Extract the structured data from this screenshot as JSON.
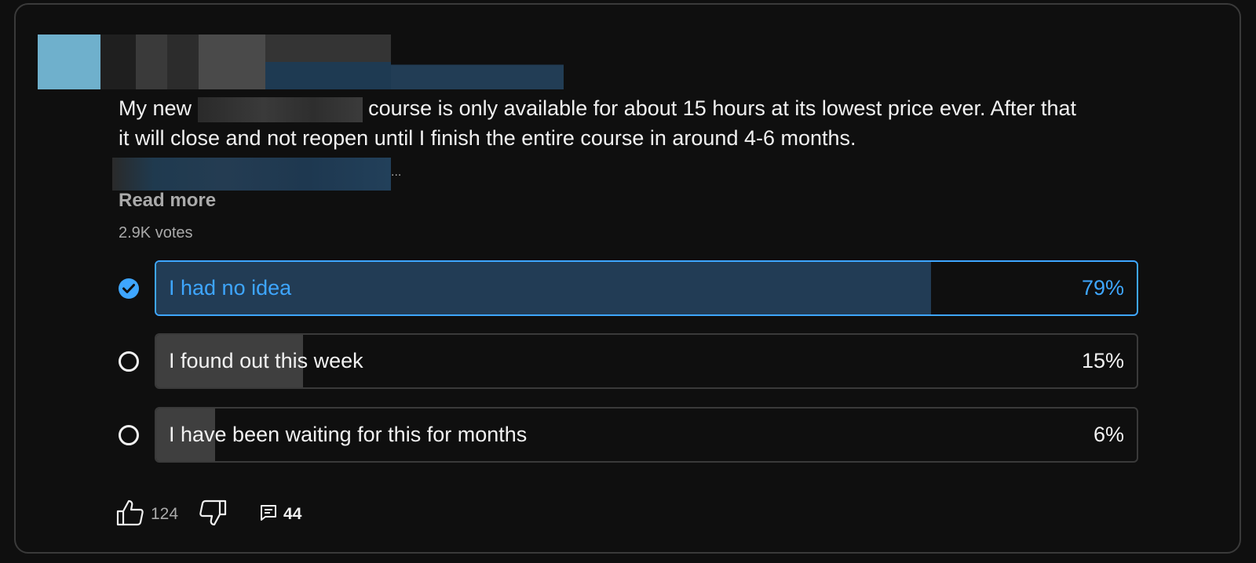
{
  "post": {
    "text_line1_start": "My new",
    "text_line1_end": "course is only available for about 15 hours at its lowest price ever. After that",
    "text_line2": "it will close and not reopen until I finish the entire course in around 4-6 months.",
    "ellipsis": "...",
    "read_more": "Read more"
  },
  "poll": {
    "votes": "2.9K votes",
    "options": [
      {
        "label": "I had no idea",
        "percent": "79%",
        "fill": 0.79,
        "selected": true
      },
      {
        "label": "I found out this week",
        "percent": "15%",
        "fill": 0.15,
        "selected": false
      },
      {
        "label": "I have been waiting for this for months",
        "percent": "6%",
        "fill": 0.06,
        "selected": false
      }
    ]
  },
  "actions": {
    "like_count": "124",
    "comment_count": "44",
    "icons": [
      "thumbs-up-icon",
      "thumbs-down-icon",
      "comment-icon"
    ]
  },
  "colors": {
    "background": "#0f0f0f",
    "accent": "#3ea6ff",
    "selected_fill": "#223c55",
    "fill": "#3f3f3f",
    "muted_text": "#aaaaaa"
  }
}
